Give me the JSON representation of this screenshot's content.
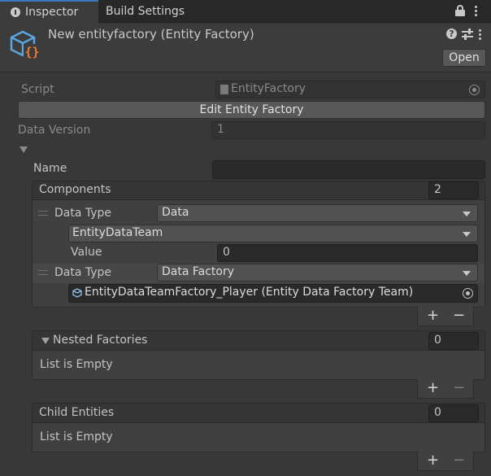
{
  "tabs": [
    {
      "label": "Inspector",
      "active": true
    },
    {
      "label": "Build Settings",
      "active": false
    }
  ],
  "header": {
    "title": "New entityfactory (Entity Factory)",
    "open_button": "Open"
  },
  "fields": {
    "script_label": "Script",
    "script_value": "EntityFactory",
    "edit_button": "Edit Entity Factory",
    "data_version_label": "Data Version",
    "data_version_value": "1",
    "name_label": "Name",
    "name_value": ""
  },
  "components": {
    "label": "Components",
    "count": "2",
    "items": [
      {
        "label": "Data Type",
        "type": "Data",
        "class": "EntityDataTeam",
        "value_label": "Value",
        "value": "0"
      },
      {
        "label": "Data Type",
        "type": "Data Factory",
        "reference": "EntityDataTeamFactory_Player (Entity Data Factory Team)"
      }
    ]
  },
  "nested_factories": {
    "label": "Nested Factories",
    "count": "0",
    "empty_text": "List is Empty"
  },
  "child_entities": {
    "label": "Child Entities",
    "count": "0",
    "empty_text": "List is Empty"
  },
  "list_controls": {
    "add": "+",
    "remove": "−"
  },
  "colors": {
    "accent": "#3a79bb",
    "icon_blue": "#5aa6e0",
    "icon_orange": "#f07c2a",
    "background": "#383838"
  }
}
